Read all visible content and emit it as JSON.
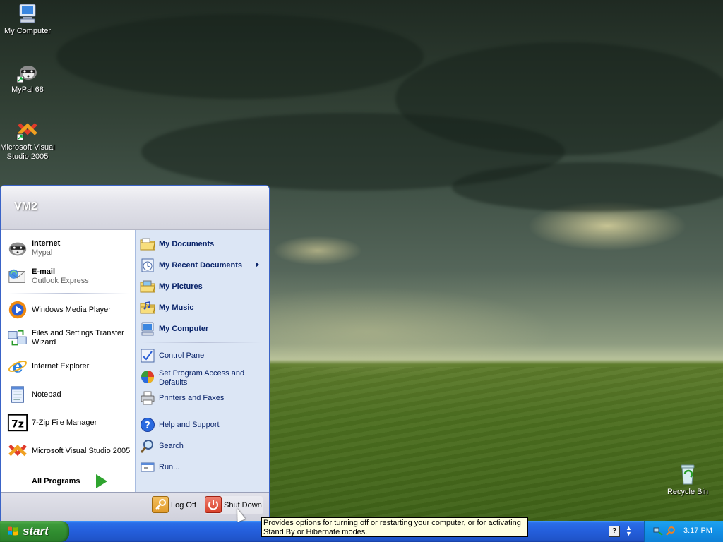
{
  "desktop": {
    "icons": [
      {
        "label": "My Computer",
        "icon": "my-computer-icon"
      },
      {
        "label": "MyPal 68",
        "icon": "raccoon-icon"
      },
      {
        "label": "Microsoft Visual Studio 2005",
        "icon": "visual-studio-icon"
      },
      {
        "label": "Recycle Bin",
        "icon": "recycle-bin-icon"
      }
    ]
  },
  "start_menu": {
    "user": "VM2",
    "left": {
      "pinned": [
        {
          "title": "Internet",
          "subtitle": "Mypal",
          "icon": "raccoon-icon"
        },
        {
          "title": "E-mail",
          "subtitle": "Outlook Express",
          "icon": "email-icon"
        }
      ],
      "recent": [
        {
          "label": "Windows Media Player",
          "icon": "media-player-icon"
        },
        {
          "label": "Files and Settings Transfer Wizard",
          "icon": "transfer-wizard-icon"
        },
        {
          "label": "Internet Explorer",
          "icon": "internet-explorer-icon"
        },
        {
          "label": "Notepad",
          "icon": "notepad-icon"
        },
        {
          "label": "7-Zip File Manager",
          "icon": "7zip-icon"
        },
        {
          "label": "Microsoft Visual Studio 2005",
          "icon": "visual-studio-icon"
        }
      ],
      "all_programs": "All Programs"
    },
    "right": {
      "places": [
        {
          "label": "My Documents",
          "icon": "folder-icon"
        },
        {
          "label": "My Recent Documents",
          "icon": "recent-documents-icon"
        },
        {
          "label": "My Pictures",
          "icon": "pictures-folder-icon"
        },
        {
          "label": "My Music",
          "icon": "music-folder-icon"
        },
        {
          "label": "My Computer",
          "icon": "my-computer-icon"
        }
      ],
      "settings": [
        {
          "label": "Control Panel",
          "icon": "control-panel-icon"
        },
        {
          "label": "Set Program Access and Defaults",
          "icon": "program-defaults-icon"
        },
        {
          "label": "Printers and Faxes",
          "icon": "printer-icon"
        }
      ],
      "tools": [
        {
          "label": "Help and Support",
          "icon": "help-icon"
        },
        {
          "label": "Search",
          "icon": "search-icon"
        },
        {
          "label": "Run...",
          "icon": "run-icon"
        }
      ]
    },
    "footer": {
      "log_off": "Log Off",
      "shut_down": "Shut Down"
    }
  },
  "tooltip": "Provides options for turning off or restarting your computer, or for activating Stand By or Hibernate modes.",
  "taskbar": {
    "start_label": "start",
    "clock": "3:17 PM"
  },
  "colors": {
    "taskbar_blue": "#245edb",
    "start_green": "#3c9a3a",
    "menu_right_panel": "#dce6f5",
    "link_text": "#0a246a",
    "log_off_orange": "#e8a23a",
    "shut_down_red": "#e04a3a"
  }
}
